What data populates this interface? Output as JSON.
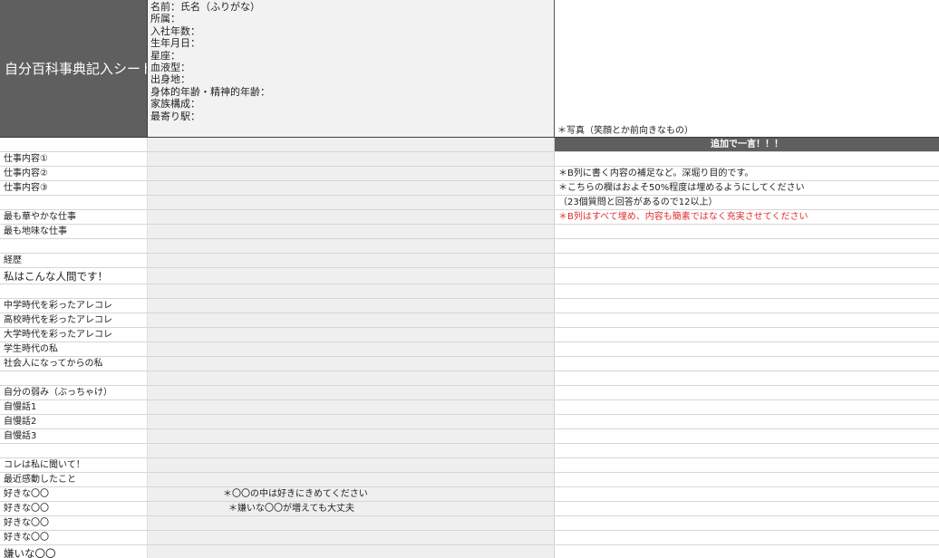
{
  "sheet": {
    "title": "自分百科事典記入シート",
    "profile_lines": [
      "名前：氏名（ふりがな）",
      "所属：",
      "入社年数：",
      "生年月日：",
      "星座：",
      "血液型：",
      "出身地：",
      "身体的年齢・精神的年齢：",
      "家族構成：",
      "最寄り駅："
    ],
    "photo_note": "＊写真（笑顔とか前向きなもの）",
    "col_c_header": "追加で一言！！！",
    "rows": [
      {
        "a": "",
        "b": "",
        "c": ""
      },
      {
        "a": "仕事内容①",
        "b": "",
        "c": ""
      },
      {
        "a": "仕事内容②",
        "b": "",
        "c": "＊B列に書く内容の補足など。深堀り目的です。"
      },
      {
        "a": "仕事内容③",
        "b": "",
        "c": "＊こちらの欄はおよそ50%程度は埋めるようにしてください"
      },
      {
        "a": "",
        "b": "",
        "c": "（23個質問と回答があるので12以上）"
      },
      {
        "a": "最も華やかな仕事",
        "b": "",
        "c": "＊B列はすべて埋め、内容も簡素ではなく充実させてください"
      },
      {
        "a": "最も地味な仕事",
        "b": "",
        "c": ""
      },
      {
        "a": "",
        "b": "",
        "c": ""
      },
      {
        "a": "経歴",
        "b": "",
        "c": ""
      },
      {
        "a": "私はこんな人間です！",
        "b": "",
        "c": ""
      },
      {
        "a": "",
        "b": "",
        "c": ""
      },
      {
        "a": "中学時代を彩ったアレコレ",
        "b": "",
        "c": ""
      },
      {
        "a": "高校時代を彩ったアレコレ",
        "b": "",
        "c": ""
      },
      {
        "a": "大学時代を彩ったアレコレ",
        "b": "",
        "c": ""
      },
      {
        "a": "学生時代の私",
        "b": "",
        "c": ""
      },
      {
        "a": "社会人になってからの私",
        "b": "",
        "c": ""
      },
      {
        "a": "",
        "b": "",
        "c": ""
      },
      {
        "a": "自分の弱み（ぶっちゃけ）",
        "b": "",
        "c": ""
      },
      {
        "a": "自慢話1",
        "b": "",
        "c": ""
      },
      {
        "a": "自慢話2",
        "b": "",
        "c": ""
      },
      {
        "a": "自慢話3",
        "b": "",
        "c": ""
      },
      {
        "a": "",
        "b": "",
        "c": ""
      },
      {
        "a": "コレは私に聞いて！",
        "b": "",
        "c": ""
      },
      {
        "a": "最近感動したこと",
        "b": "",
        "c": ""
      },
      {
        "a": "好きな〇〇",
        "b": "＊〇〇の中は好きにきめてください",
        "c": ""
      },
      {
        "a": "好きな〇〇",
        "b": "＊嫌いな〇〇が増えても大丈夫",
        "c": ""
      },
      {
        "a": "好きな〇〇",
        "b": "",
        "c": ""
      },
      {
        "a": "好きな〇〇",
        "b": "",
        "c": ""
      },
      {
        "a": "嫌いな〇〇",
        "b": "",
        "c": ""
      }
    ]
  }
}
